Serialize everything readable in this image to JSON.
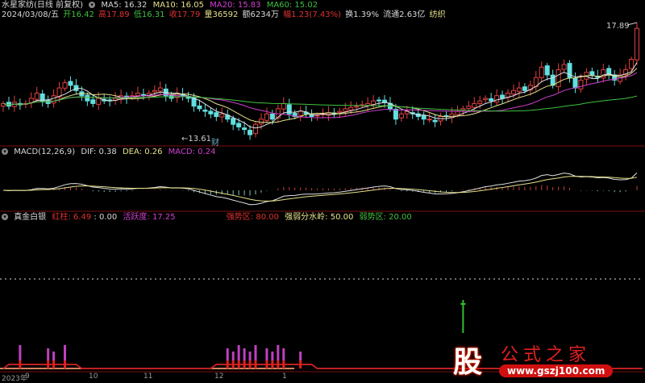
{
  "header": {
    "title": "水星家纺(日线 前复权)",
    "ma": [
      {
        "label": "MA5: 16.32"
      },
      {
        "label": "MA10: 16.05"
      },
      {
        "label": "MA20: 15.83"
      },
      {
        "label": "MA60: 15.02"
      }
    ],
    "date": "2024/03/08/五",
    "open": "开16.42",
    "high": "高17.89",
    "low": "低16.31",
    "close": "收17.79",
    "volume": "量36592",
    "amount": "额6234万",
    "change": "幅1.23(7.43%)",
    "turnover": "换1.39%",
    "float": "流通2.63亿",
    "sector": "纺织"
  },
  "main": {
    "high_label": "17.89",
    "low_label": "13.61",
    "event_marker": "财"
  },
  "macd": {
    "title": "MACD(12,26,9)",
    "dif": "DIF: 0.38",
    "dea": "DEA: 0.26",
    "macd": "MACD: 0.24"
  },
  "indicator": {
    "title": "真金白银",
    "red_label": "红柱: 6.49",
    "value": ": 0.00",
    "activity": "活跃度: 17.25",
    "strong": "强势区: 80.00",
    "divide": "强弱分水岭: 50.00",
    "weak": "弱势区: 20.00",
    "signals": [
      3,
      8,
      9,
      11,
      40,
      41,
      42,
      43,
      44,
      45,
      47,
      48,
      49,
      50,
      53
    ],
    "green_signal": 82
  },
  "axis": {
    "labels": [
      "2023年",
      "9",
      "10",
      "11",
      "12",
      "1"
    ]
  },
  "logo": {
    "char": "股",
    "text": "公式之家",
    "url": "www.gszj100.com"
  },
  "prices": [
    14.9,
    14.8,
    14.95,
    14.85,
    14.9,
    15.1,
    15.3,
    15.0,
    14.9,
    15.2,
    15.5,
    15.7,
    15.6,
    15.4,
    15.2,
    15.0,
    14.9,
    15.1,
    15.0,
    15.0,
    15.1,
    15.2,
    15.1,
    15.2,
    15.3,
    15.2,
    15.3,
    15.4,
    15.5,
    15.2,
    15.1,
    15.3,
    15.2,
    15.1,
    14.8,
    14.7,
    14.6,
    14.5,
    14.4,
    14.5,
    14.3,
    14.1,
    14.0,
    13.9,
    13.7,
    14.1,
    14.3,
    14.5,
    14.3,
    14.7,
    14.9,
    14.5,
    14.4,
    14.6,
    14.5,
    14.4,
    14.45,
    14.5,
    14.55,
    14.5,
    14.6,
    14.7,
    14.75,
    14.8,
    14.85,
    14.9,
    15.0,
    15.0,
    14.95,
    14.7,
    14.3,
    14.5,
    14.6,
    14.5,
    14.4,
    14.3,
    14.3,
    14.2,
    14.4,
    14.4,
    14.5,
    14.6,
    14.7,
    14.8,
    14.9,
    15.0,
    15.1,
    15.0,
    15.2,
    15.1,
    15.3,
    15.4,
    15.5,
    15.4,
    15.6,
    15.9,
    16.3,
    16.0,
    15.6,
    16.2,
    16.4,
    15.9,
    15.5,
    15.8,
    16.1,
    16.0,
    15.9,
    16.2,
    16.0,
    15.8,
    16.0,
    16.2,
    16.6,
    17.79
  ]
}
